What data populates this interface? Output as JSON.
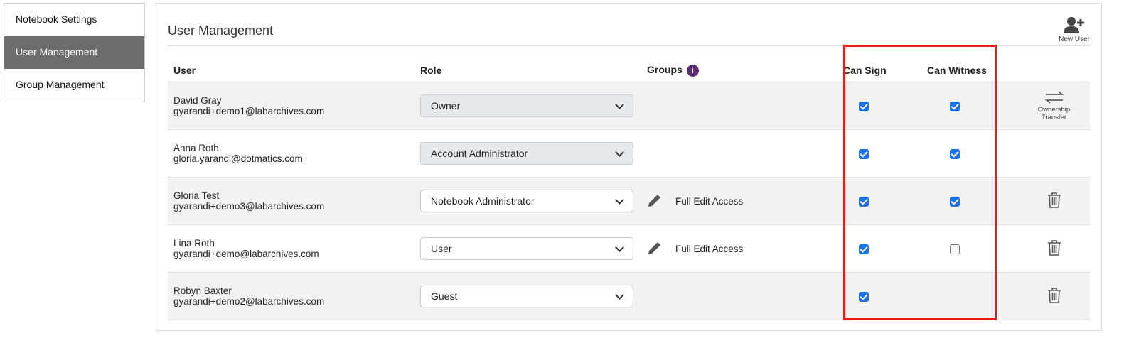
{
  "sidebar": {
    "items": [
      {
        "label": "Notebook Settings",
        "active": false
      },
      {
        "label": "User Management",
        "active": true
      },
      {
        "label": "Group Management",
        "active": false
      }
    ]
  },
  "main": {
    "title": "User Management",
    "new_user_label": "New User",
    "columns": {
      "user": "User",
      "role": "Role",
      "groups": "Groups",
      "can_sign": "Can Sign",
      "can_witness": "Can Witness"
    },
    "rows": [
      {
        "name": "David Gray",
        "email": "gyarandi+demo1@labarchives.com",
        "role": "Owner",
        "role_disabled": true,
        "group": "",
        "can_sign": true,
        "can_witness": true,
        "action": "ownership-transfer",
        "action_label_1": "Ownership",
        "action_label_2": "Transfer"
      },
      {
        "name": "Anna Roth",
        "email": "gloria.yarandi@dotmatics.com",
        "role": "Account Administrator",
        "role_disabled": true,
        "group": "",
        "can_sign": true,
        "can_witness": true,
        "action": "none"
      },
      {
        "name": "Gloria Test",
        "email": "gyarandi+demo3@labarchives.com",
        "role": "Notebook Administrator",
        "role_disabled": false,
        "group": "Full Edit Access",
        "can_sign": true,
        "can_witness": true,
        "action": "delete"
      },
      {
        "name": "Lina Roth",
        "email": "gyarandi+demo@labarchives.com",
        "role": "User",
        "role_disabled": false,
        "group": "Full Edit Access",
        "can_sign": true,
        "can_witness": false,
        "action": "delete"
      },
      {
        "name": "Robyn Baxter",
        "email": "gyarandi+demo2@labarchives.com",
        "role": "Guest",
        "role_disabled": false,
        "group": "",
        "can_sign": true,
        "can_witness": null,
        "action": "delete"
      }
    ]
  },
  "colors": {
    "active_sidebar": "#6c6c6c",
    "checkbox": "#1a73e8",
    "highlight_box": "#e61b1b",
    "info_icon": "#5b2a73"
  }
}
